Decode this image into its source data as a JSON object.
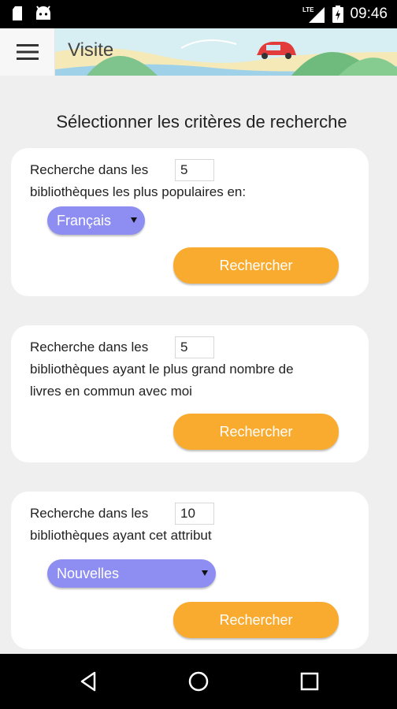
{
  "status_bar": {
    "time": "09:46",
    "icons": [
      "sd-card-icon",
      "android-icon",
      "lte-signal-icon",
      "battery-icon"
    ]
  },
  "app_bar": {
    "title": "Visite",
    "menu_icon": "hamburger-menu-icon"
  },
  "heading": "Sélectionner les critères de recherche",
  "cards": [
    {
      "text_prefix": "Recherche dans les",
      "count": "5",
      "text_rest": "bibliothèques les plus populaires en:",
      "select_value": "Français",
      "button": "Rechercher"
    },
    {
      "text_prefix": "Recherche dans les",
      "count": "5",
      "text_rest_1": "bibliothèques ayant le plus grand nombre de",
      "text_rest_2": "livres en commun avec moi",
      "button": "Rechercher"
    },
    {
      "text_prefix": "Recherche dans les",
      "count": "10",
      "text_rest": "bibliothèques ayant cet attribut",
      "select_value": "Nouvelles",
      "button": "Rechercher"
    }
  ],
  "nav_bar": {
    "icons": [
      "back-icon",
      "home-icon",
      "recents-icon"
    ]
  },
  "colors": {
    "accent_button": "#f9ab2f",
    "select": "#8e8ef2",
    "background": "#efefef"
  }
}
